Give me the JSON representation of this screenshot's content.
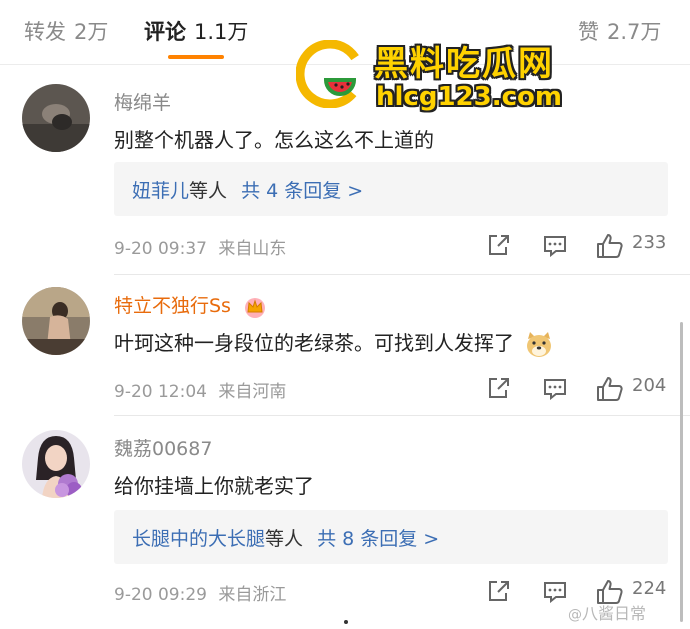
{
  "tabs": {
    "repost": {
      "label": "转发",
      "count": "2万"
    },
    "comment": {
      "label": "评论",
      "count": "1.1万"
    },
    "like": {
      "label": "赞",
      "count": "2.7万"
    }
  },
  "accent_color": "#ff8200",
  "watermark": {
    "title": "黑料吃瓜网",
    "url": "hlcg123.com"
  },
  "comments": [
    {
      "username": "梅绵羊",
      "text": "别整个机器人了。怎么这么不上道的",
      "reply": {
        "names": "妞菲儿",
        "suffix": "等人",
        "count_text": "共 4 条回复 >"
      },
      "time": "9-20 09:37",
      "location": "来自山东",
      "likes": "233"
    },
    {
      "username": "特立不独行Ss",
      "text": "叶珂这种一身段位的老绿茶。可找到人发挥了",
      "time": "9-20 12:04",
      "location": "来自河南",
      "likes": "204"
    },
    {
      "username": "魏荔00687",
      "text": "给你挂墙上你就老实了",
      "reply": {
        "names": "长腿中的大长腿",
        "suffix": "等人",
        "count_text": "共 8 条回复 >"
      },
      "time": "9-20 09:29",
      "location": "来自浙江",
      "likes": "224"
    }
  ],
  "footer_watermark": "八酱日常"
}
